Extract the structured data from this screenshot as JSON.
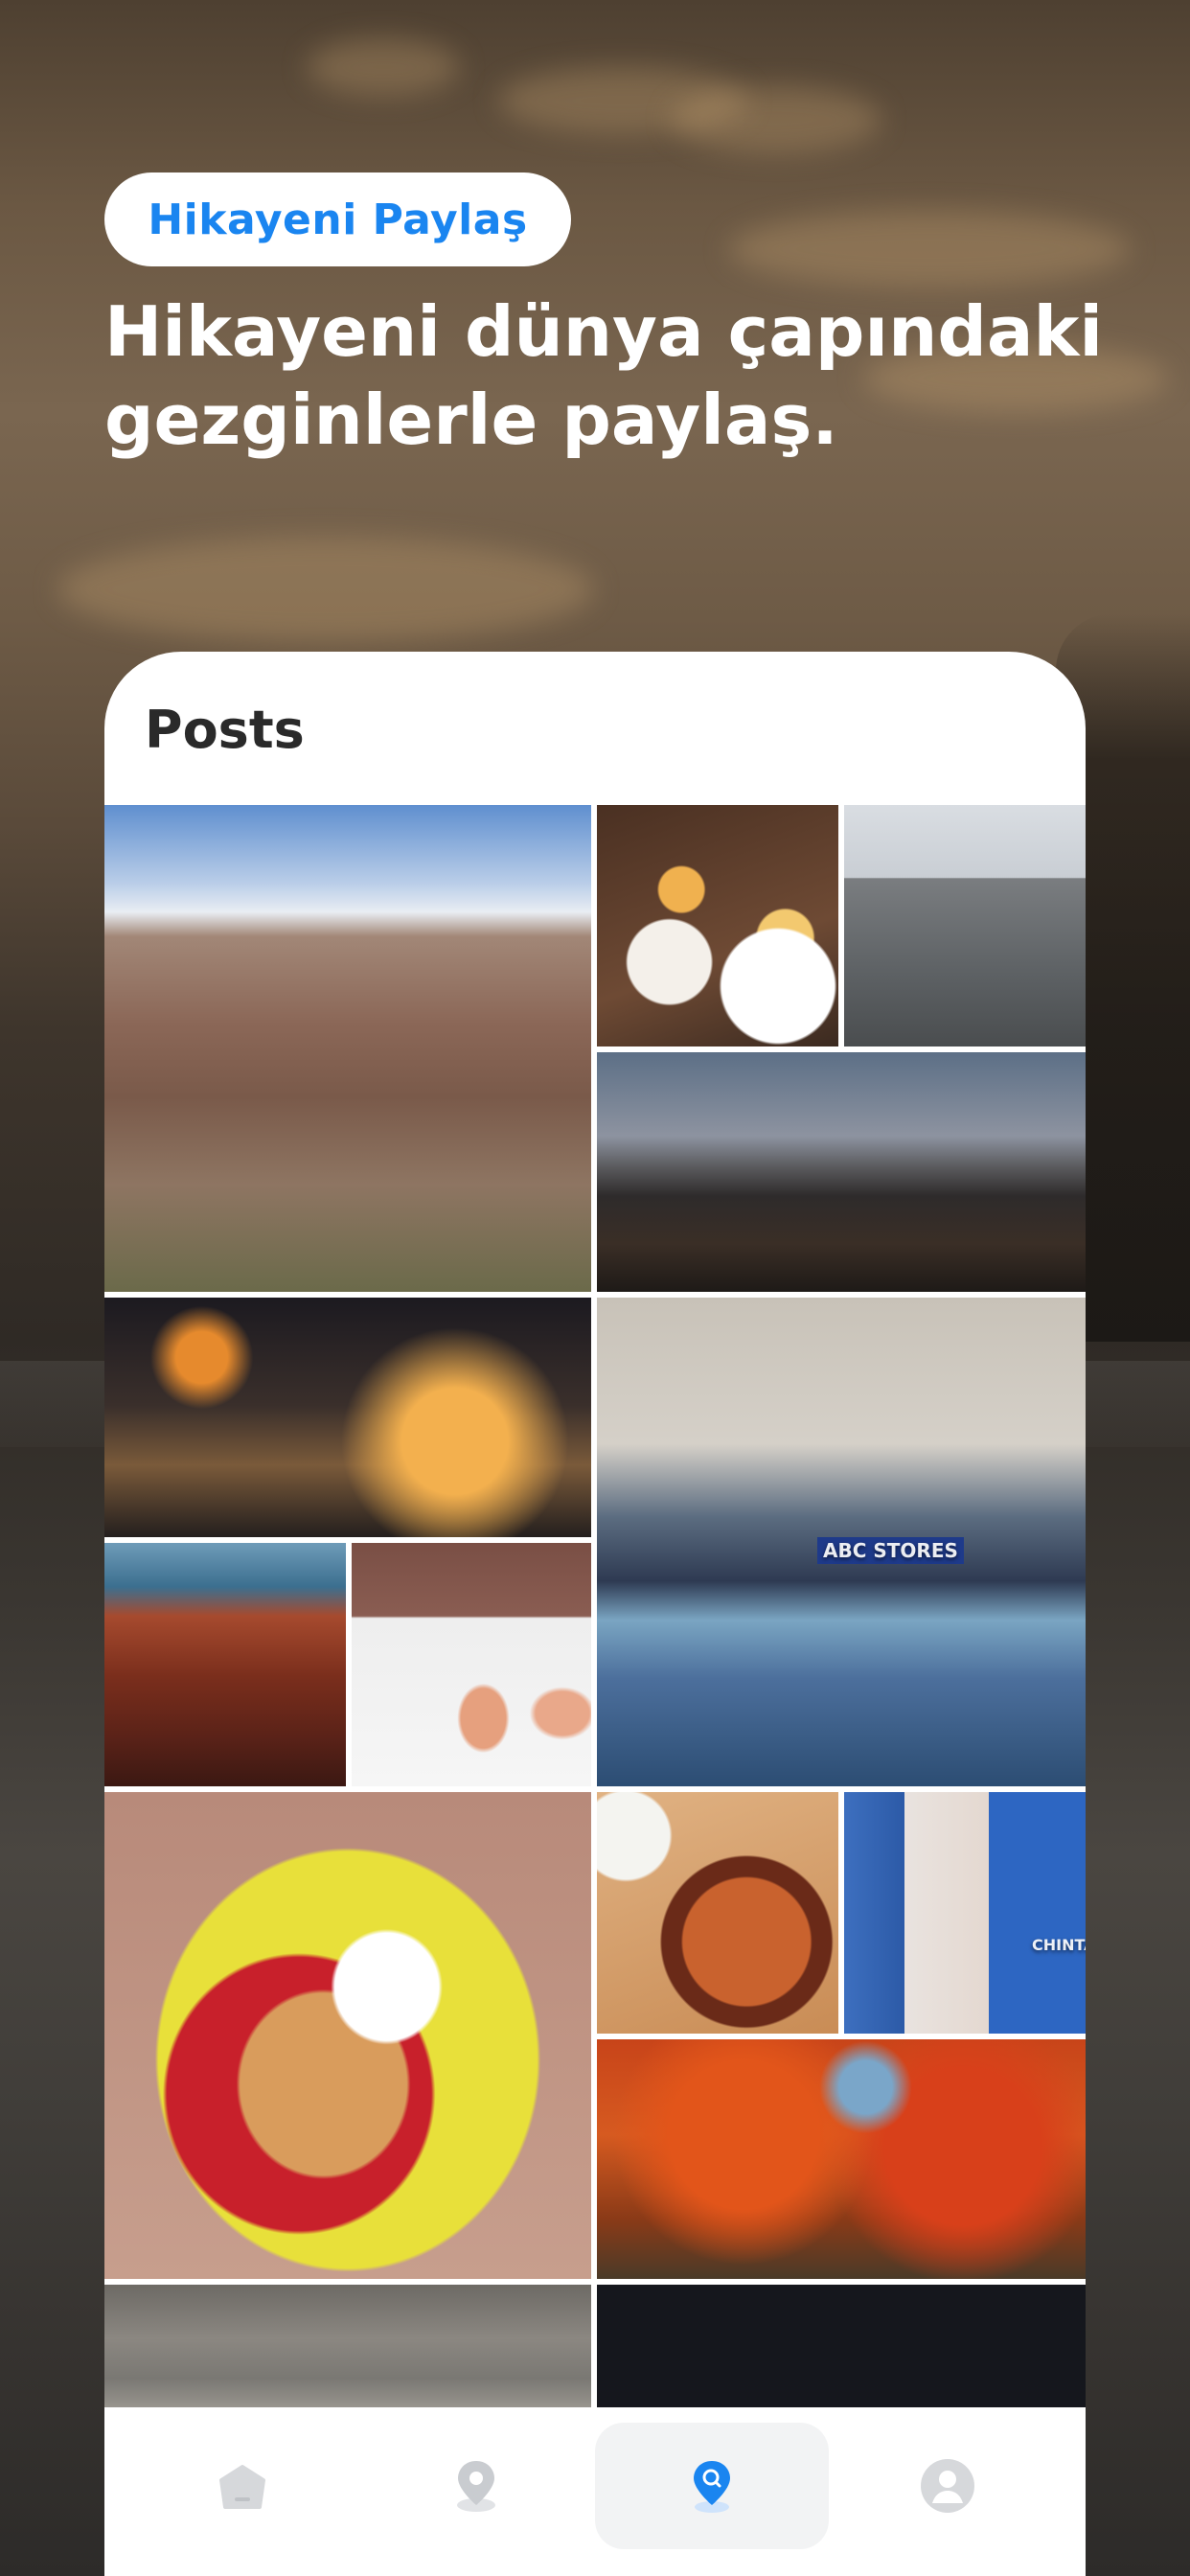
{
  "header": {
    "pill_label": "Hikayeni Paylaş",
    "headline_line1": "Hikayeni dünya çapındaki",
    "headline_line2": "gezginlerle paylaş."
  },
  "card": {
    "title": "Posts"
  },
  "posts": [
    {
      "subject": "Grand canyon landscape"
    },
    {
      "subject": "Cakes and coffee"
    },
    {
      "subject": "Gothic cathedral"
    },
    {
      "subject": "City skyline at dusk"
    },
    {
      "subject": "Lakeside nightlife"
    },
    {
      "subject": "ABC Stores interior with gashapon machines"
    },
    {
      "subject": "Restaurant interior"
    },
    {
      "subject": "Ceramic bunny figures on bed"
    },
    {
      "subject": "Crepes with whipped cream"
    },
    {
      "subject": "Garlic shrimp dish"
    },
    {
      "subject": "Dotonbori billboards"
    },
    {
      "subject": "Autumn red maple trees"
    },
    {
      "subject": "Plaza fountain with people"
    },
    {
      "subject": "Dark night photo"
    }
  ],
  "visible_photo_text": {
    "mall_sign": "ABC STORES",
    "osaka_sign": "CHINTAI"
  },
  "nav": {
    "items": [
      "home-icon",
      "map-pin-icon",
      "search-pin-icon",
      "profile-icon"
    ],
    "active_index": 2,
    "accent_color": "#1a85f0",
    "inactive_color": "#d6d8db"
  },
  "colors": {
    "pill_text": "#1a85f0",
    "headline": "#ffffff",
    "card_title": "#2a2a2a"
  }
}
